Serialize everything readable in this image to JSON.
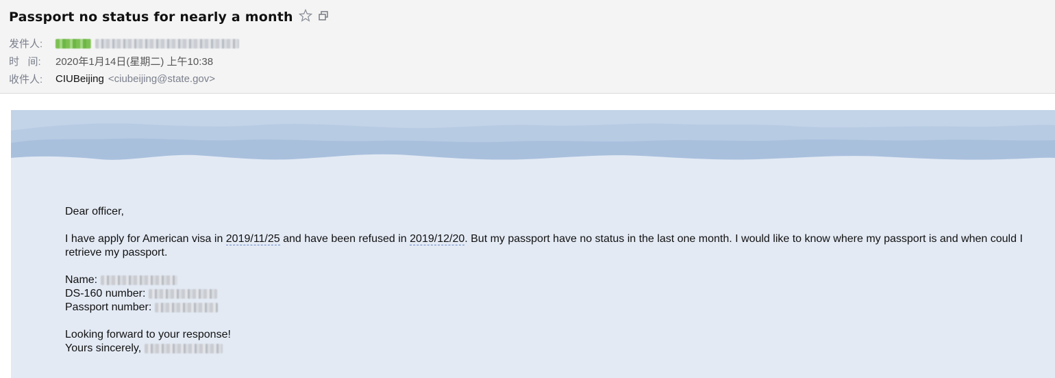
{
  "email": {
    "subject": "Passport no status for nearly a month",
    "from_label": "发件人:",
    "time_label": "时   间:",
    "time_value": "2020年1月14日(星期二) 上午10:38",
    "to_label": "收件人:",
    "to_name": "CIUBeijing",
    "to_address": "<ciubeijing@state.gov>"
  },
  "icons": {
    "star": "star-outline-icon",
    "popout": "open-new-window-icon"
  },
  "message": {
    "greeting": "Dear officer,",
    "para1_a": "I have apply for American visa in ",
    "date1": "2019/11/25",
    "para1_b": " and have been refused in ",
    "date2": "2019/12/20",
    "para1_c": ". But my passport have no status in the last one month. I would like to know where my passport is and when could I retrieve my passport.",
    "name_label": "Name:",
    "ds160_label": "DS-160 number:",
    "passport_label": "Passport number:",
    "closing1": "Looking forward to your response!",
    "closing2": "Yours sincerely,"
  }
}
